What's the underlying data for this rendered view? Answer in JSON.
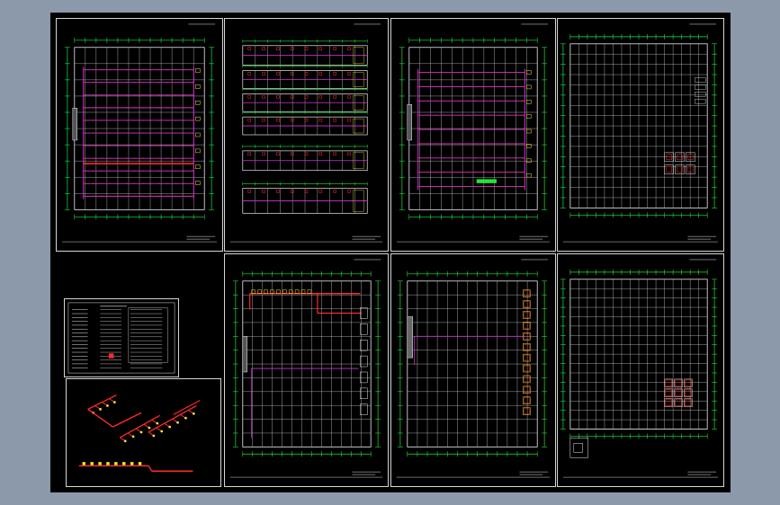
{
  "colors": {
    "background": "#8c99ab",
    "canvas": "#000000",
    "sheet_border": "#d6d6d6",
    "grid_green": "#22e33a",
    "wall_white": "#e8e8e8",
    "pipe_magenta": "#d233d8",
    "pipe_red": "#ff2a2a",
    "equipment_yellow": "#f2e23a"
  },
  "sheets": [
    {
      "id": "plan-1",
      "kind": "pipe-plan",
      "pipes": "dense-magenta",
      "redline": true
    },
    {
      "id": "plan-2",
      "kind": "sections"
    },
    {
      "id": "plan-3",
      "kind": "pipe-plan",
      "pipes": "dense-magenta",
      "redline": false
    },
    {
      "id": "plan-4",
      "kind": "grid-plan"
    },
    {
      "id": "plan-5",
      "kind": "pipe-plan",
      "pipes": "sparse-red"
    },
    {
      "id": "plan-6",
      "kind": "pipe-plan",
      "pipes": "sparse-magenta"
    },
    {
      "id": "plan-7",
      "kind": "grid-plan"
    }
  ],
  "panels": [
    {
      "id": "legend-table",
      "kind": "table"
    },
    {
      "id": "isometric-view",
      "kind": "isometric"
    }
  ]
}
